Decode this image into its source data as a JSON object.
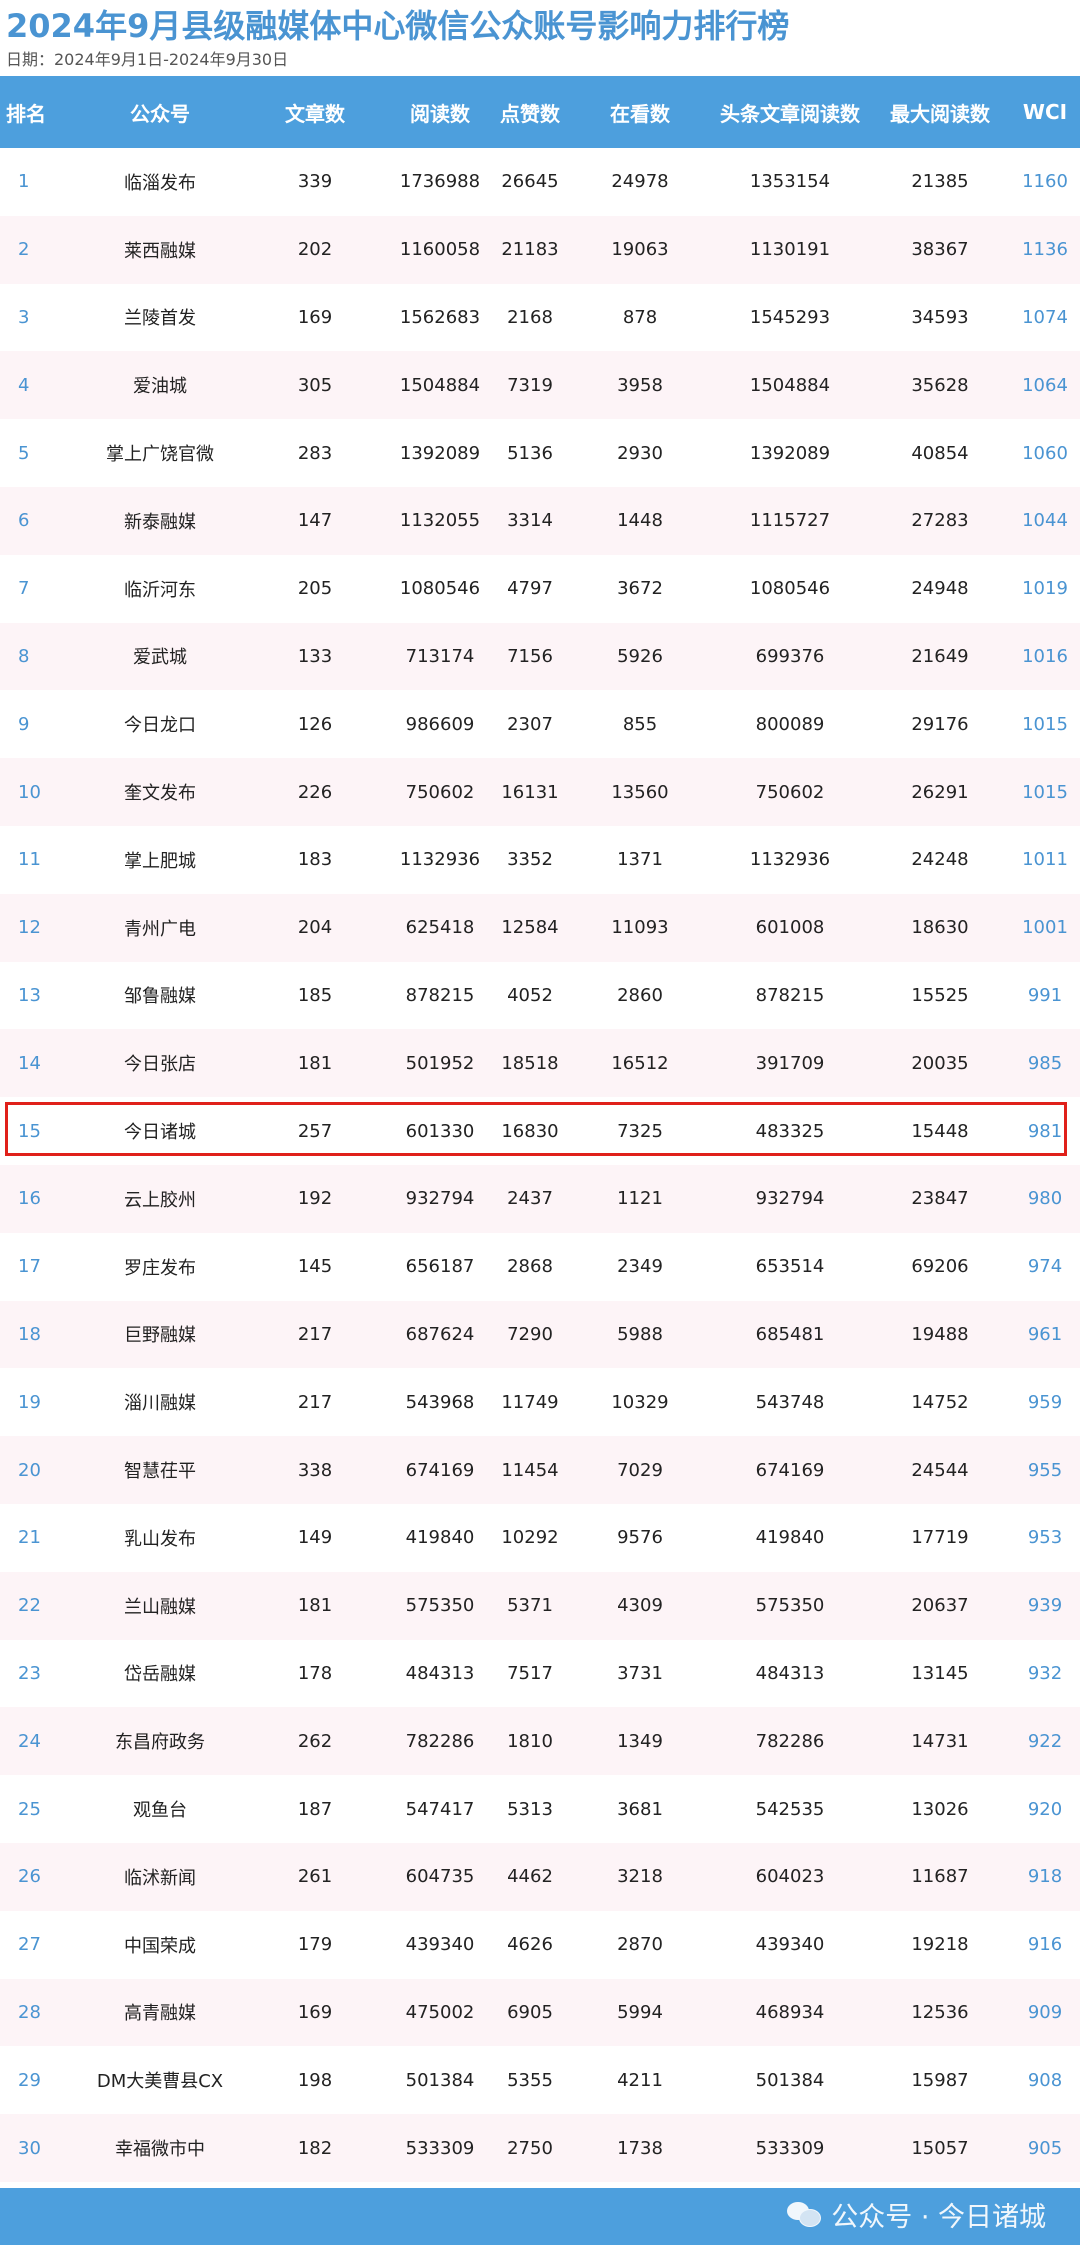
{
  "title": "2024年9月县级融媒体中心微信公众账号影响力排行榜",
  "date": "日期：2024年9月1日-2024年9月30日",
  "columns": [
    "排名",
    "公众号",
    "文章数",
    "阅读数",
    "点赞数",
    "在看数",
    "头条文章阅读数",
    "最大阅读数",
    "WCI"
  ],
  "rows": [
    [
      "1",
      "临淄发布",
      "339",
      "1736988",
      "26645",
      "24978",
      "1353154",
      "21385",
      "1160"
    ],
    [
      "2",
      "莱西融媒",
      "202",
      "1160058",
      "21183",
      "19063",
      "1130191",
      "38367",
      "1136"
    ],
    [
      "3",
      "兰陵首发",
      "169",
      "1562683",
      "2168",
      "878",
      "1545293",
      "34593",
      "1074"
    ],
    [
      "4",
      "爱油城",
      "305",
      "1504884",
      "7319",
      "3958",
      "1504884",
      "35628",
      "1064"
    ],
    [
      "5",
      "掌上广饶官微",
      "283",
      "1392089",
      "5136",
      "2930",
      "1392089",
      "40854",
      "1060"
    ],
    [
      "6",
      "新泰融媒",
      "147",
      "1132055",
      "3314",
      "1448",
      "1115727",
      "27283",
      "1044"
    ],
    [
      "7",
      "临沂河东",
      "205",
      "1080546",
      "4797",
      "3672",
      "1080546",
      "24948",
      "1019"
    ],
    [
      "8",
      "爱武城",
      "133",
      "713174",
      "7156",
      "5926",
      "699376",
      "21649",
      "1016"
    ],
    [
      "9",
      "今日龙口",
      "126",
      "986609",
      "2307",
      "855",
      "800089",
      "29176",
      "1015"
    ],
    [
      "10",
      "奎文发布",
      "226",
      "750602",
      "16131",
      "13560",
      "750602",
      "26291",
      "1015"
    ],
    [
      "11",
      "掌上肥城",
      "183",
      "1132936",
      "3352",
      "1371",
      "1132936",
      "24248",
      "1011"
    ],
    [
      "12",
      "青州广电",
      "204",
      "625418",
      "12584",
      "11093",
      "601008",
      "18630",
      "1001"
    ],
    [
      "13",
      "邹鲁融媒",
      "185",
      "878215",
      "4052",
      "2860",
      "878215",
      "15525",
      "991"
    ],
    [
      "14",
      "今日张店",
      "181",
      "501952",
      "18518",
      "16512",
      "391709",
      "20035",
      "985"
    ],
    [
      "15",
      "今日诸城",
      "257",
      "601330",
      "16830",
      "7325",
      "483325",
      "15448",
      "981"
    ],
    [
      "16",
      "云上胶州",
      "192",
      "932794",
      "2437",
      "1121",
      "932794",
      "23847",
      "980"
    ],
    [
      "17",
      "罗庄发布",
      "145",
      "656187",
      "2868",
      "2349",
      "653514",
      "69206",
      "974"
    ],
    [
      "18",
      "巨野融媒",
      "217",
      "687624",
      "7290",
      "5988",
      "685481",
      "19488",
      "961"
    ],
    [
      "19",
      "淄川融媒",
      "217",
      "543968",
      "11749",
      "10329",
      "543748",
      "14752",
      "959"
    ],
    [
      "20",
      "智慧茌平",
      "338",
      "674169",
      "11454",
      "7029",
      "674169",
      "24544",
      "955"
    ],
    [
      "21",
      "乳山发布",
      "149",
      "419840",
      "10292",
      "9576",
      "419840",
      "17719",
      "953"
    ],
    [
      "22",
      "兰山融媒",
      "181",
      "575350",
      "5371",
      "4309",
      "575350",
      "20637",
      "939"
    ],
    [
      "23",
      "岱岳融媒",
      "178",
      "484313",
      "7517",
      "3731",
      "484313",
      "13145",
      "932"
    ],
    [
      "24",
      "东昌府政务",
      "262",
      "782286",
      "1810",
      "1349",
      "782286",
      "14731",
      "922"
    ],
    [
      "25",
      "观鱼台",
      "187",
      "547417",
      "5313",
      "3681",
      "542535",
      "13026",
      "920"
    ],
    [
      "26",
      "临沭新闻",
      "261",
      "604735",
      "4462",
      "3218",
      "604023",
      "11687",
      "918"
    ],
    [
      "27",
      "中国荣成",
      "179",
      "439340",
      "4626",
      "2870",
      "439340",
      "19218",
      "916"
    ],
    [
      "28",
      "高青融媒",
      "169",
      "475002",
      "6905",
      "5994",
      "468934",
      "12536",
      "909"
    ],
    [
      "29",
      "DM大美曹县CX",
      "198",
      "501384",
      "5355",
      "4211",
      "501384",
      "15987",
      "908"
    ],
    [
      "30",
      "幸福微市中",
      "182",
      "533309",
      "2750",
      "1738",
      "533309",
      "15057",
      "905"
    ]
  ],
  "highlighted_rank": "15",
  "watermark": "公众号 · 今日诸城",
  "watermark_icon": "wechat-icon",
  "colors": {
    "title": "#4a94d2",
    "header_bg": "#4d9fdd",
    "row_alt_bg": "#fdf4f7",
    "highlight_border": "#e0201a",
    "rank_text": "#4a94d2"
  }
}
